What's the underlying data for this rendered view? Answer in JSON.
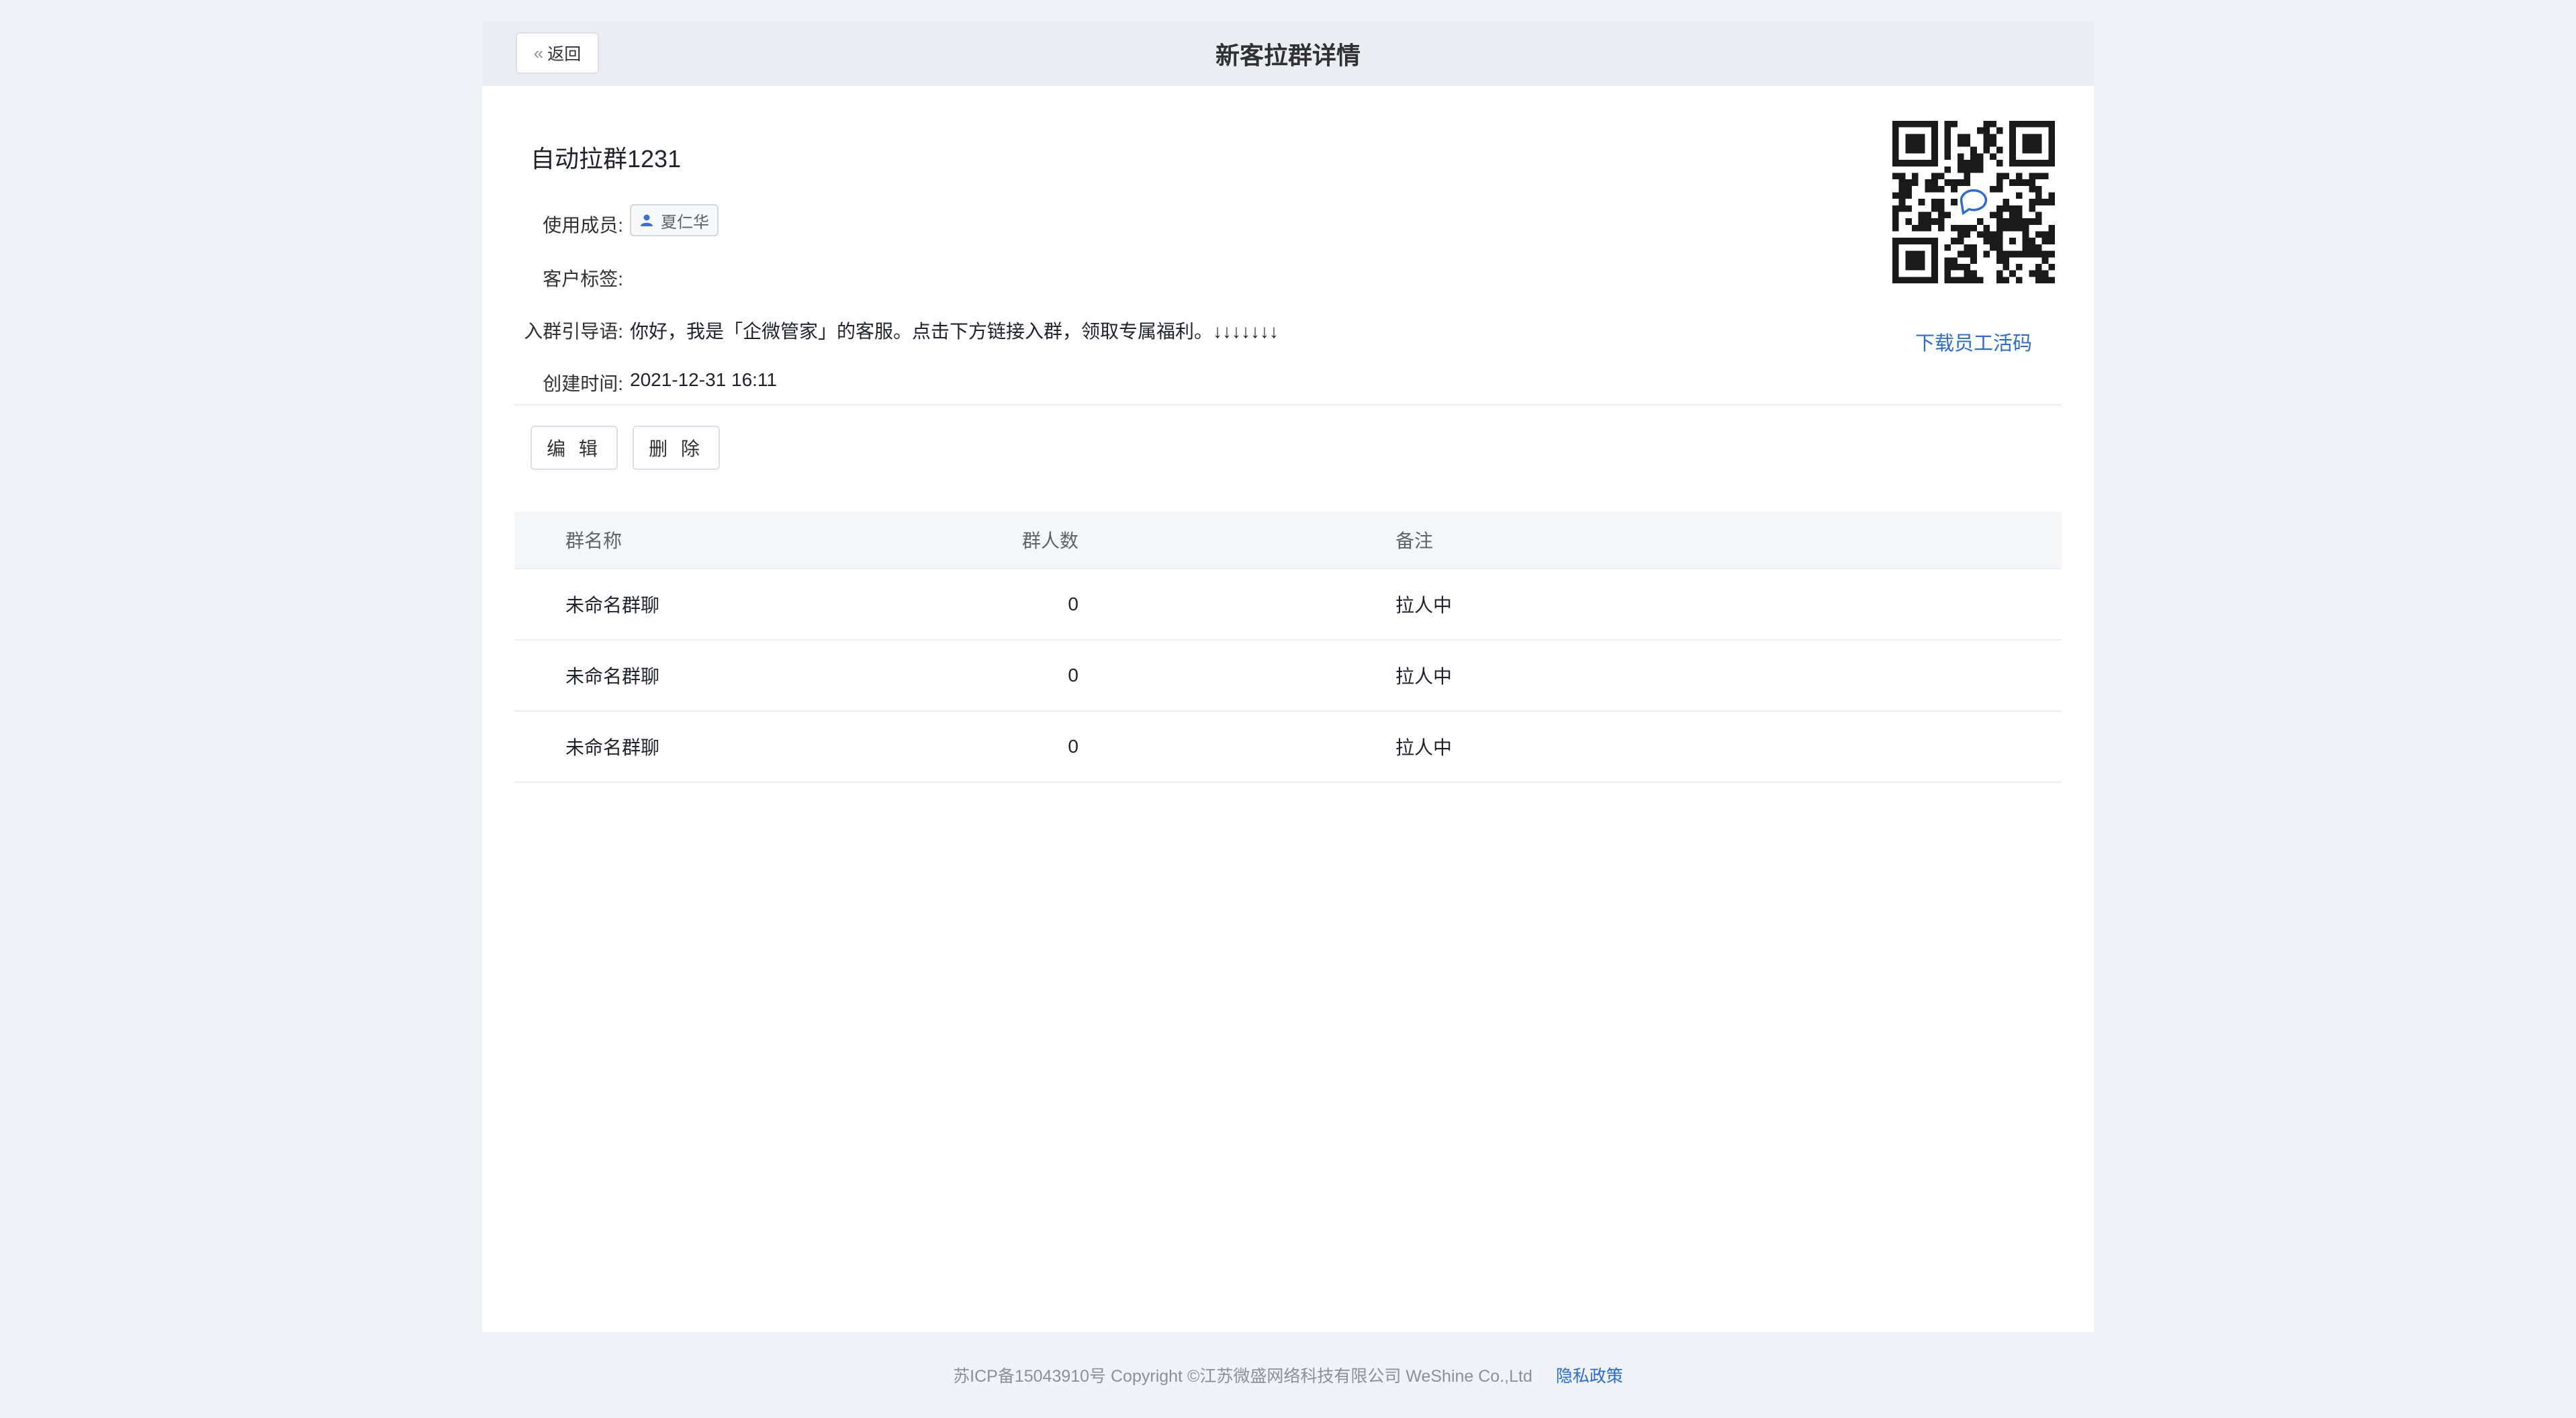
{
  "header": {
    "back_label": "返回",
    "title": "新客拉群详情"
  },
  "detail": {
    "task_name": "自动拉群1231",
    "member_label": "使用成员:",
    "member_name": "夏仁华",
    "tags_label": "客户标签:",
    "welcome_label": "入群引导语:",
    "welcome_text": "你好，我是「企微管家」的客服。点击下方链接入群，领取专属福利。↓↓↓↓↓↓↓",
    "created_label": "创建时间:",
    "created_value": "2021-12-31 16:11"
  },
  "qr": {
    "download_label": "下载员工活码"
  },
  "actions": {
    "edit_label": "编 辑",
    "delete_label": "删 除"
  },
  "table": {
    "columns": [
      "群名称",
      "群人数",
      "备注"
    ],
    "rows": [
      {
        "name": "未命名群聊",
        "count": "0",
        "note": "拉人中"
      },
      {
        "name": "未命名群聊",
        "count": "0",
        "note": "拉人中"
      },
      {
        "name": "未命名群聊",
        "count": "0",
        "note": "拉人中"
      }
    ]
  },
  "footer": {
    "copyright": "苏ICP备15043910号 Copyright ©江苏微盛网络科技有限公司 WeShine Co.,Ltd",
    "privacy_label": "隐私政策"
  },
  "colors": {
    "page_background": "#eff2f7",
    "header_background": "#ebedf2",
    "link": "#2b6bd6"
  }
}
